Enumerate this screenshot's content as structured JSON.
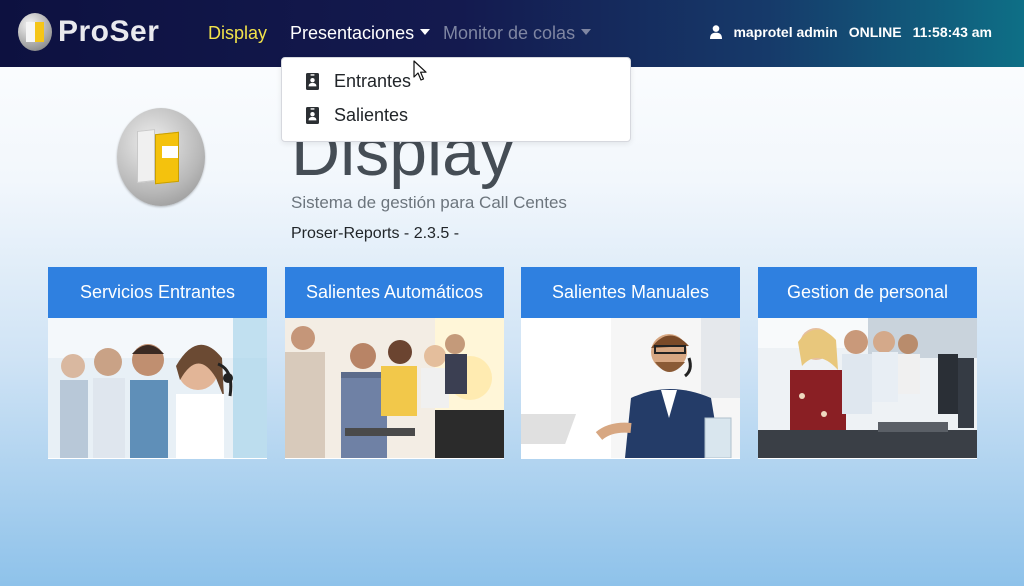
{
  "navbar": {
    "brand": "ProSer",
    "links": {
      "display": "Display",
      "presentaciones": "Presentaciones",
      "monitor": "Monitor de colas"
    },
    "user": "maprotel admin",
    "status": "ONLINE",
    "time": "11:58:43 am"
  },
  "dropdown": {
    "items": [
      {
        "label": "Entrantes",
        "icon": "id-card-icon"
      },
      {
        "label": "Salientes",
        "icon": "id-card-icon"
      }
    ]
  },
  "hero": {
    "title": "Display",
    "subtitle": "Sistema de gestión para Call Centes",
    "version": "Proser-Reports - 2.3.5 -"
  },
  "cards": [
    {
      "title": "Servicios Entrantes"
    },
    {
      "title": "Salientes Automáticos"
    },
    {
      "title": "Salientes Manuales"
    },
    {
      "title": "Gestion de personal"
    }
  ],
  "colors": {
    "accent": "#2f80e0",
    "active_link": "#f2e34a",
    "navbar_dark": "#0d1140"
  }
}
